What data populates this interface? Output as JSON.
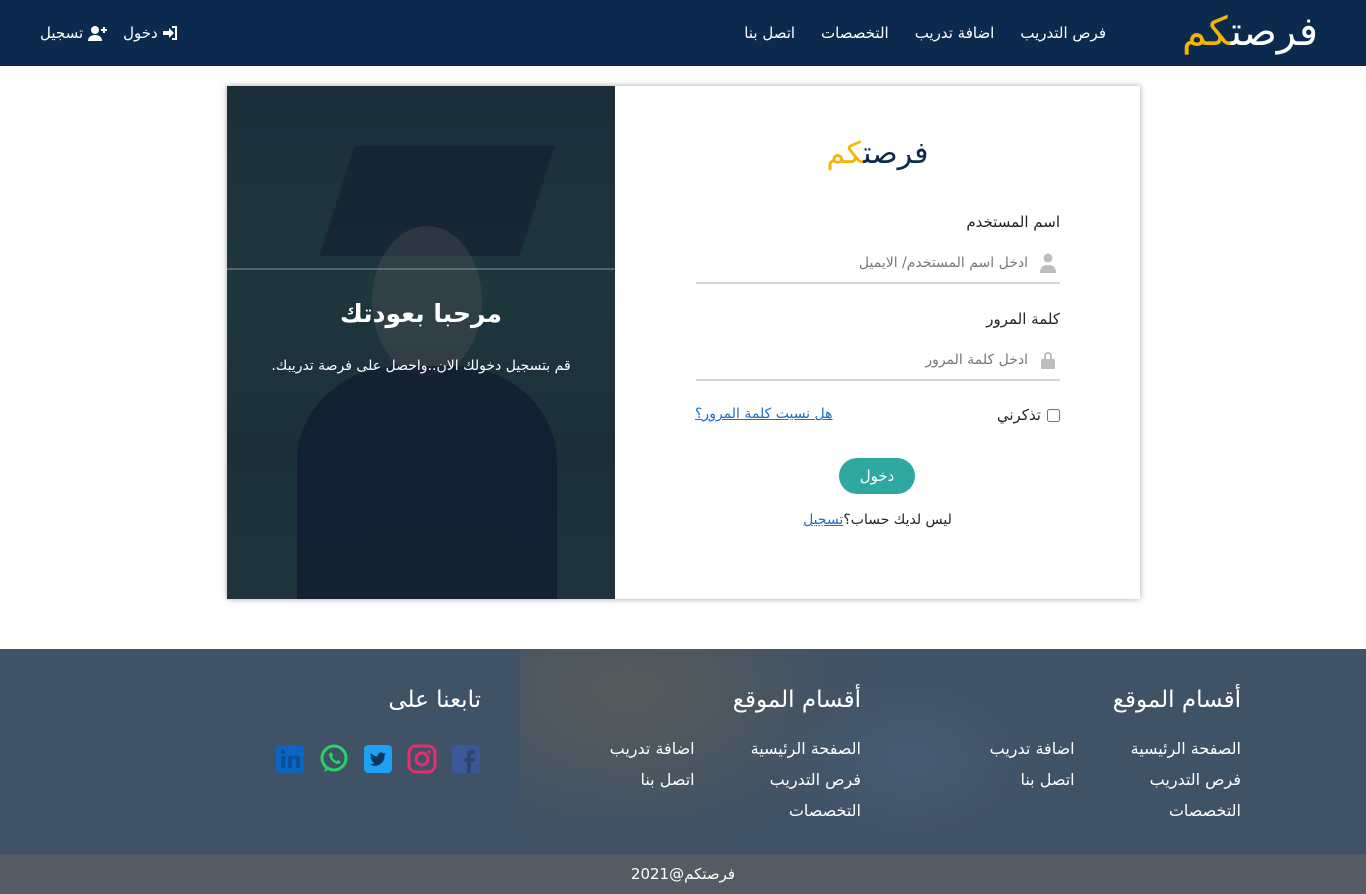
{
  "navbar": {
    "brand_part1": "فرصت",
    "brand_part2": "كم",
    "links": [
      "فرص التدريب",
      "اضافة تدريب",
      "التخصصات",
      "اتصل بنا"
    ],
    "login_label": "دخول",
    "register_label": "تسجيل"
  },
  "welcome": {
    "title": "مرحبا بعودتك",
    "text": "قم بتسجيل دخولك الان..واحصل على فرصة تدريبك."
  },
  "form": {
    "brand_part1": "فرصت",
    "brand_part2": "كم",
    "username_label": "اسم المستخدم",
    "username_placeholder": "ادخل اسم المستخدم/ الايميل",
    "password_label": "كلمة المرور",
    "password_placeholder": "ادخل كلمة المرور",
    "remember_label": "تذكرني",
    "forgot_label": "هل نسيت كلمة المرور؟",
    "submit_label": "دخول",
    "no_account_text": "ليس لديك حساب؟",
    "signup_link": "تسجيل"
  },
  "footer": {
    "col1": {
      "title": "أقسام الموقع",
      "links": [
        "الصفحة الرئيسية",
        "اضافة تدريب",
        "فرص التدريب",
        "اتصل بنا",
        "التخصصات"
      ]
    },
    "col2": {
      "title": "أقسام الموقع",
      "links": [
        "الصفحة الرئيسية",
        "اضافة تدريب",
        "فرص التدريب",
        "اتصل بنا",
        "التخصصات"
      ]
    },
    "col3": {
      "title": "تابعنا على"
    },
    "social_icons": [
      "facebook-icon",
      "instagram-icon",
      "twitter-icon",
      "whatsapp-icon",
      "linkedin-icon"
    ],
    "copyright": "فرصتكم@2021"
  },
  "colors": {
    "navbar_bg": "#0b2a4e",
    "accent_yellow": "#f5b400",
    "button_teal": "#2ea8a0",
    "link_blue": "#1a6fc7",
    "facebook": "#3b5998",
    "instagram": "#e1306c",
    "twitter": "#1da1f2",
    "whatsapp": "#25d366",
    "linkedin": "#0a66c2"
  }
}
